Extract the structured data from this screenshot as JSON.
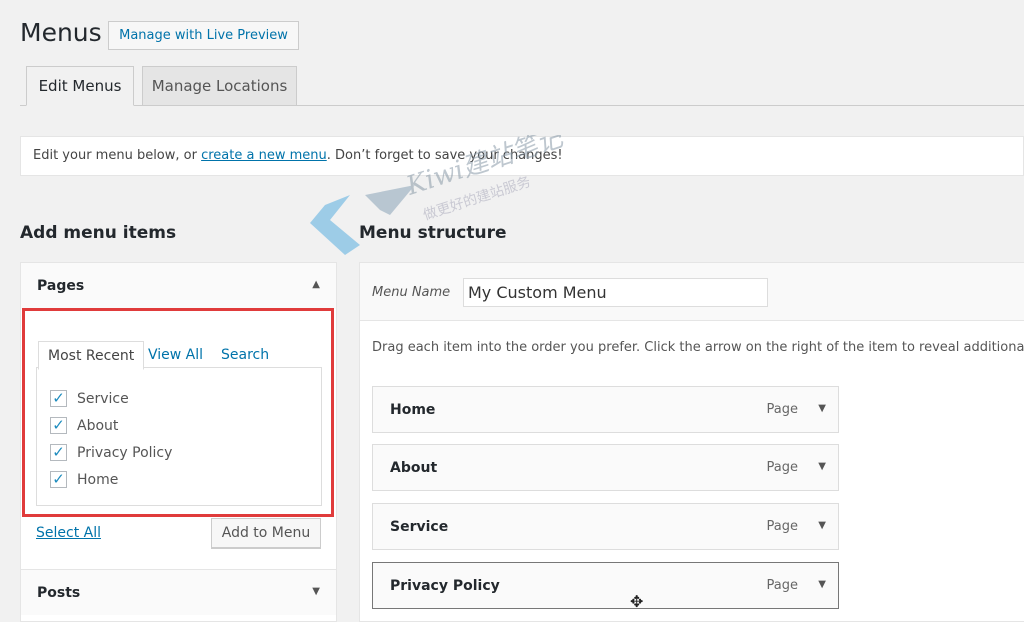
{
  "header": {
    "title": "Menus",
    "live_preview": "Manage with Live Preview"
  },
  "tabs": [
    {
      "label": "Edit Menus",
      "active": true
    },
    {
      "label": "Manage Locations",
      "active": false
    }
  ],
  "notice": {
    "before": "Edit your menu below, or ",
    "link": "create a new menu",
    "after": ". Don’t forget to save your changes!"
  },
  "left": {
    "heading": "Add menu items",
    "pages": {
      "title": "Pages",
      "tabs": [
        "Most Recent",
        "View All",
        "Search"
      ],
      "items": [
        {
          "label": "Service",
          "checked": true
        },
        {
          "label": "About",
          "checked": true
        },
        {
          "label": "Privacy Policy",
          "checked": true
        },
        {
          "label": "Home",
          "checked": true
        }
      ],
      "select_all": "Select All",
      "add_button": "Add to Menu"
    },
    "posts": {
      "title": "Posts"
    }
  },
  "right": {
    "heading": "Menu structure",
    "menu_name_label": "Menu Name",
    "menu_name_value": "My Custom Menu",
    "instructions": "Drag each item into the order you prefer. Click the arrow on the right of the item to reveal additional",
    "items": [
      {
        "label": "Home",
        "type": "Page"
      },
      {
        "label": "About",
        "type": "Page"
      },
      {
        "label": "Service",
        "type": "Page"
      },
      {
        "label": "Privacy Policy",
        "type": "Page"
      }
    ]
  },
  "watermark": {
    "text": "Kiwi建站笔记",
    "sub": "做更好的建站服务"
  },
  "colors": {
    "accent": "#0073aa",
    "highlight": "#e03b3b",
    "check": "#1e8cbe"
  }
}
